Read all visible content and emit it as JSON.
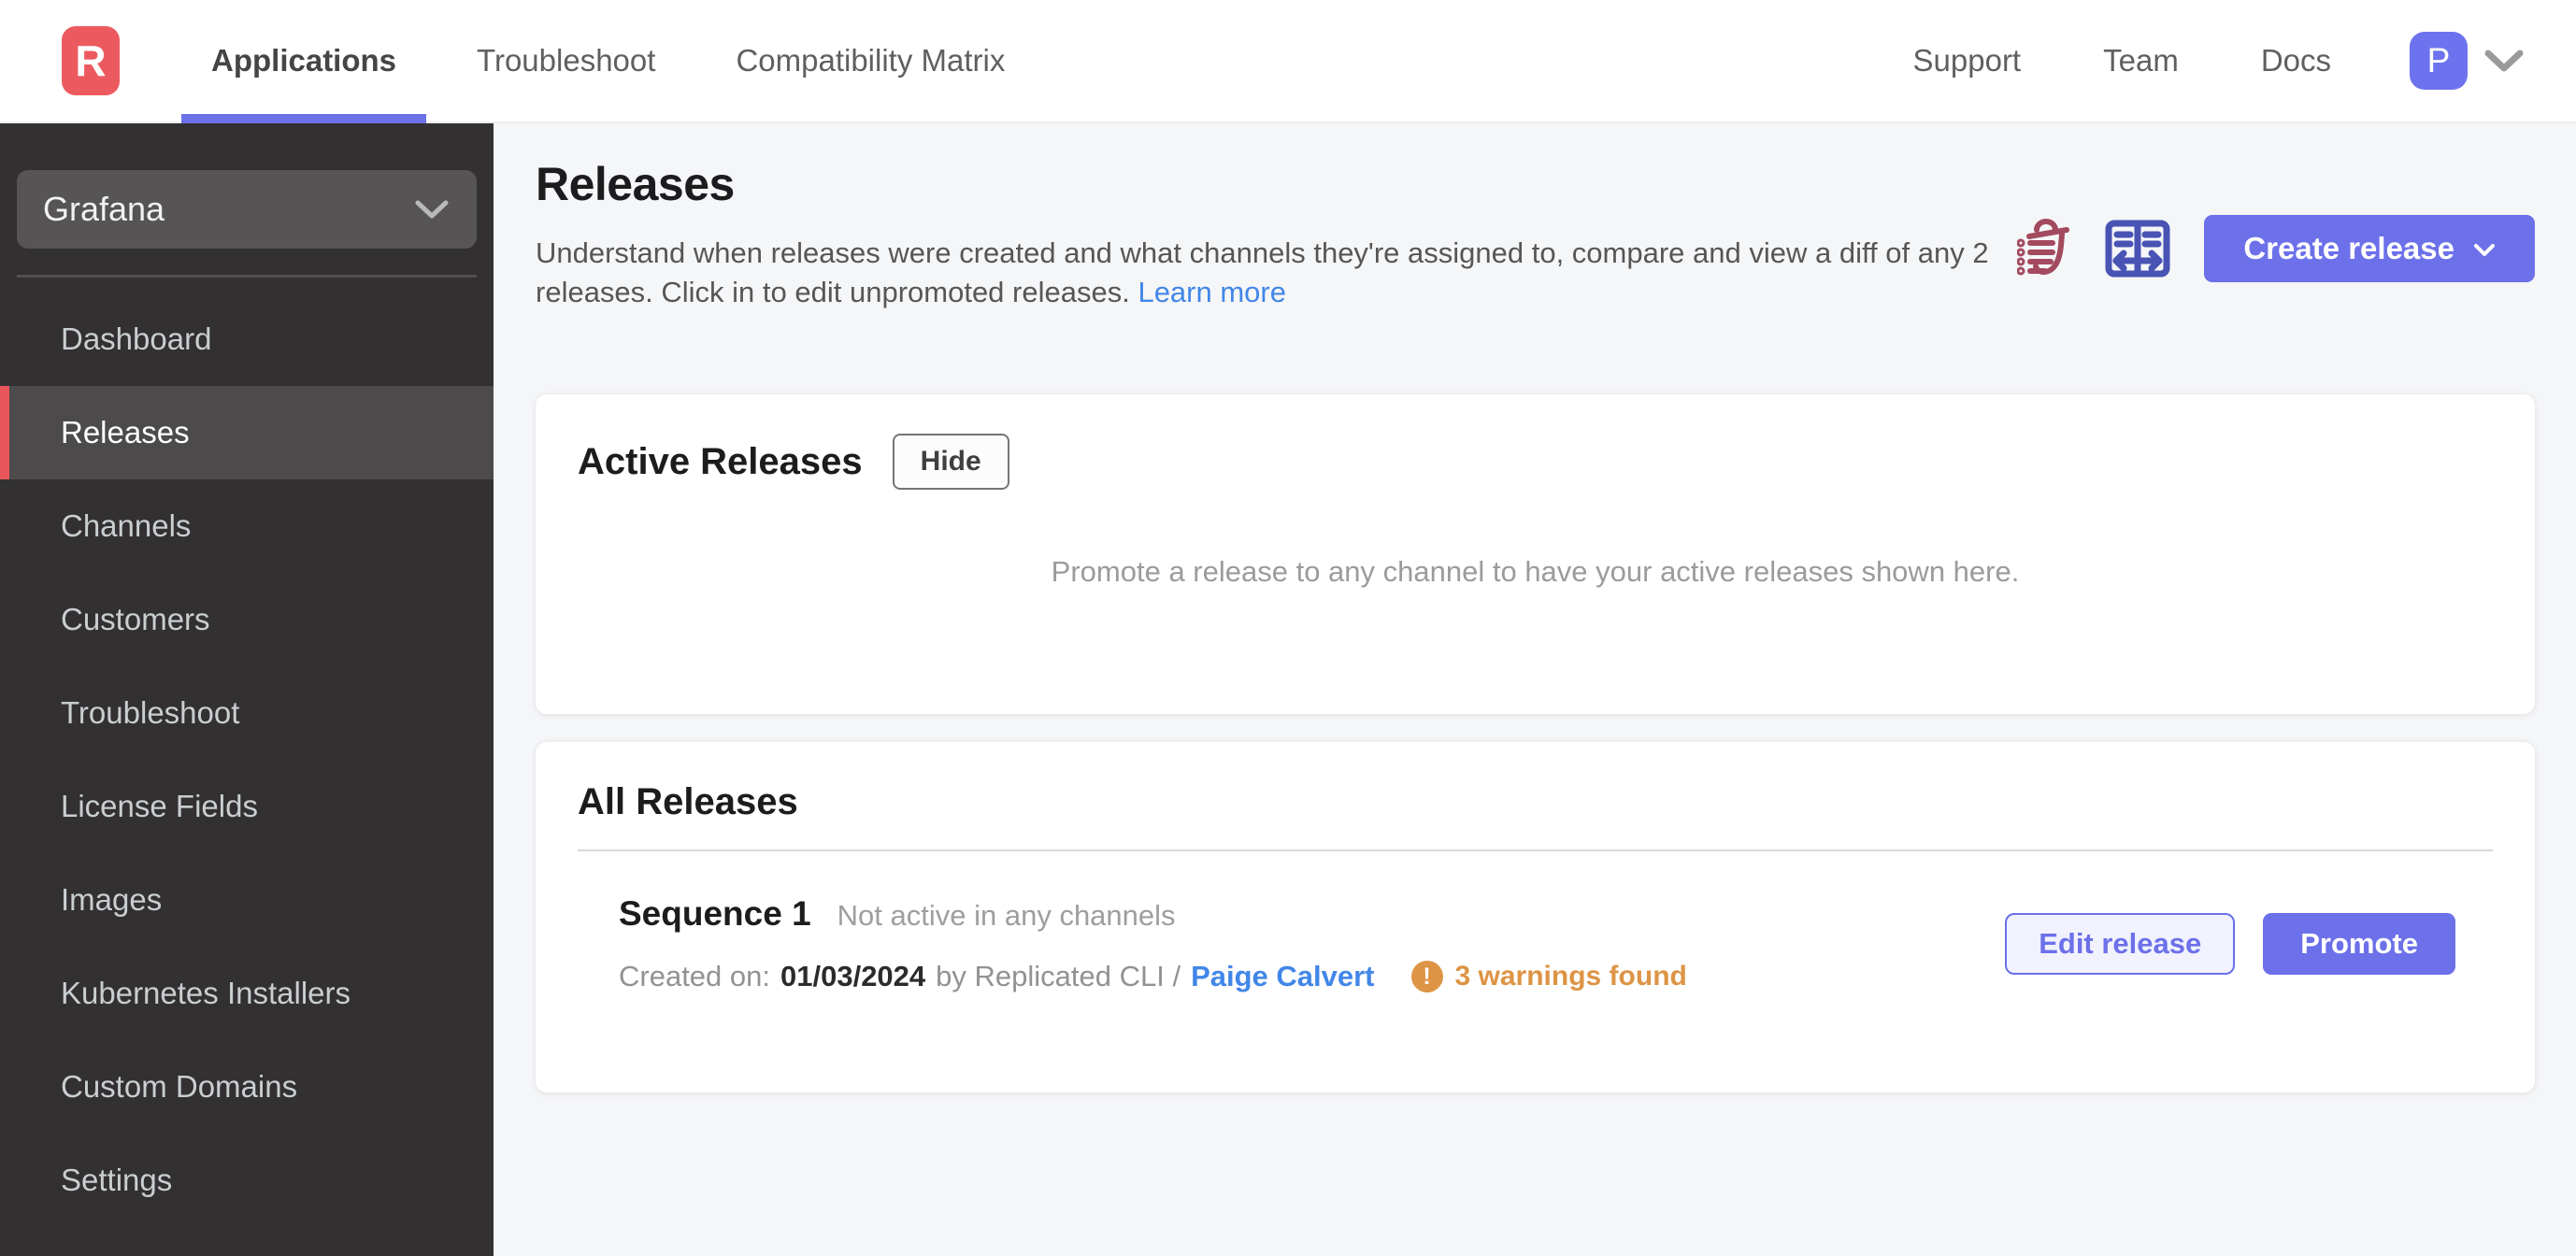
{
  "colors": {
    "accent_indigo": "#6c70e9",
    "brand_red": "#ec5a5f",
    "sidebar_active_red": "#e8565c",
    "link_blue": "#4286e8",
    "warning_orange": "#dd9445",
    "trash_icon_maroon": "#a34a5f",
    "diff_icon_indigo": "#4853b4",
    "sidebar_bg": "#323031"
  },
  "topbar": {
    "logo_letter": "R",
    "nav": [
      {
        "label": "Applications",
        "active": true
      },
      {
        "label": "Troubleshoot",
        "active": false
      },
      {
        "label": "Compatibility Matrix",
        "active": false
      }
    ],
    "right_nav": [
      {
        "label": "Support"
      },
      {
        "label": "Team"
      },
      {
        "label": "Docs"
      }
    ],
    "avatar_initial": "P"
  },
  "sidebar": {
    "app_selector": "Grafana",
    "items": [
      {
        "label": "Dashboard",
        "active": false
      },
      {
        "label": "Releases",
        "active": true
      },
      {
        "label": "Channels",
        "active": false
      },
      {
        "label": "Customers",
        "active": false
      },
      {
        "label": "Troubleshoot",
        "active": false
      },
      {
        "label": "License Fields",
        "active": false
      },
      {
        "label": "Images",
        "active": false
      },
      {
        "label": "Kubernetes Installers",
        "active": false
      },
      {
        "label": "Custom Domains",
        "active": false
      },
      {
        "label": "Settings",
        "active": false
      }
    ]
  },
  "page": {
    "title": "Releases",
    "description": "Understand when releases were created and what channels they're assigned to, compare and view a diff of any 2 releases. Click in to edit unpromoted releases.",
    "learn_more": "Learn more",
    "create_release_label": "Create release"
  },
  "active_releases": {
    "title": "Active Releases",
    "hide_label": "Hide",
    "empty_message": "Promote a release to any channel to have your active releases shown here."
  },
  "all_releases": {
    "title": "All Releases",
    "releases": [
      {
        "name": "Sequence 1",
        "status": "Not active in any channels",
        "created_prefix": "Created on:",
        "created_date": "01/03/2024",
        "created_via": "by Replicated CLI /",
        "created_author": "Paige Calvert",
        "warning_text": "3 warnings found",
        "edit_label": "Edit release",
        "promote_label": "Promote"
      }
    ]
  }
}
